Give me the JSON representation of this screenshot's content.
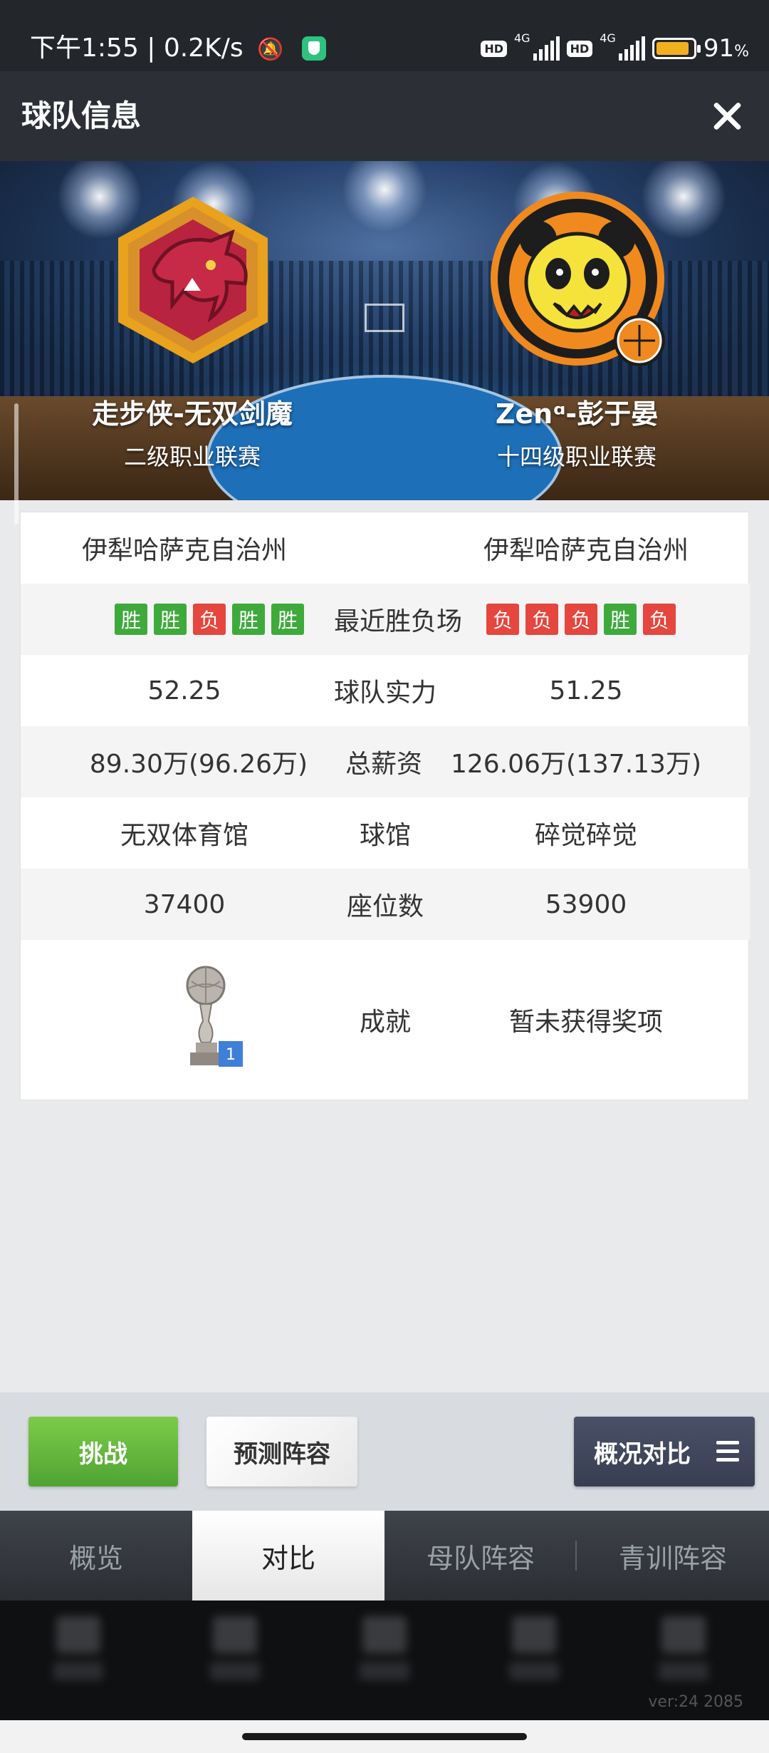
{
  "status_bar": {
    "time_speed": "下午1:55 | 0.2K/s",
    "network_1": "4G",
    "network_2": "4G",
    "hd_1": "HD",
    "hd_2": "HD",
    "battery_text": "91",
    "battery_unit": "%",
    "battery_level": 0.91
  },
  "header": {
    "title": "球队信息"
  },
  "teams": {
    "left": {
      "name": "走步侠-无双剑魔",
      "league": "二级职业联赛",
      "region": "伊犁哈萨克自治州",
      "strength": "52.25",
      "salary": "89.30万(96.26万)",
      "arena": "无双体育馆",
      "seats": "37400",
      "logo_icon": "dragon-logo-icon"
    },
    "right": {
      "name": "Zenᵅ-彭于晏",
      "league": "十四级职业联赛",
      "region": "伊犁哈萨克自治州",
      "strength": "51.25",
      "salary": "126.06万(137.13万)",
      "arena": "碎觉碎觉",
      "seats": "53900",
      "achievement": "暂未获得奖项",
      "logo_icon": "panda-logo-icon"
    }
  },
  "compare_labels": {
    "recent": "最近胜负场",
    "strength": "球队实力",
    "salary": "总薪资",
    "arena": "球馆",
    "seats": "座位数",
    "achievement": "成就"
  },
  "recent_results": {
    "left": [
      "胜",
      "胜",
      "负",
      "胜",
      "胜"
    ],
    "right": [
      "负",
      "负",
      "负",
      "胜",
      "负"
    ],
    "win_label": "胜",
    "colors": {
      "win": "#3faa3c",
      "loss": "#e5463e"
    }
  },
  "trophy": {
    "count": "1"
  },
  "actions": {
    "challenge": "挑战",
    "predict": "预测阵容",
    "overview": "概况对比"
  },
  "tabs": [
    "概览",
    "对比",
    "母队阵容",
    "青训阵容"
  ],
  "active_tab": 1,
  "version": "ver:24  2085"
}
